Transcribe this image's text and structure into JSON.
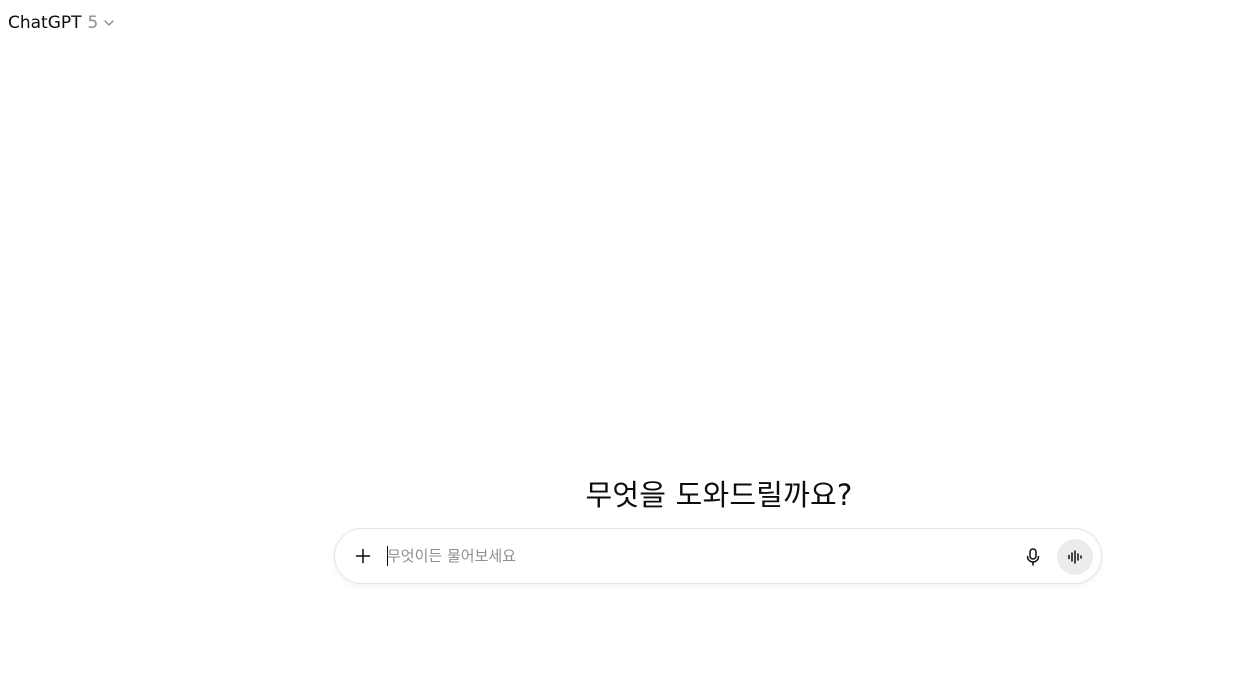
{
  "header": {
    "model_name": "ChatGPT",
    "model_version": "5",
    "icon": "chevron-down-icon"
  },
  "main": {
    "headline": "무엇을 도와드릴까요?"
  },
  "composer": {
    "placeholder": "무엇이든 물어보세요",
    "value": "",
    "buttons": {
      "attach_icon": "plus-icon",
      "dictate_icon": "microphone-icon",
      "voice_mode_icon": "voice-waveform-icon"
    }
  }
}
